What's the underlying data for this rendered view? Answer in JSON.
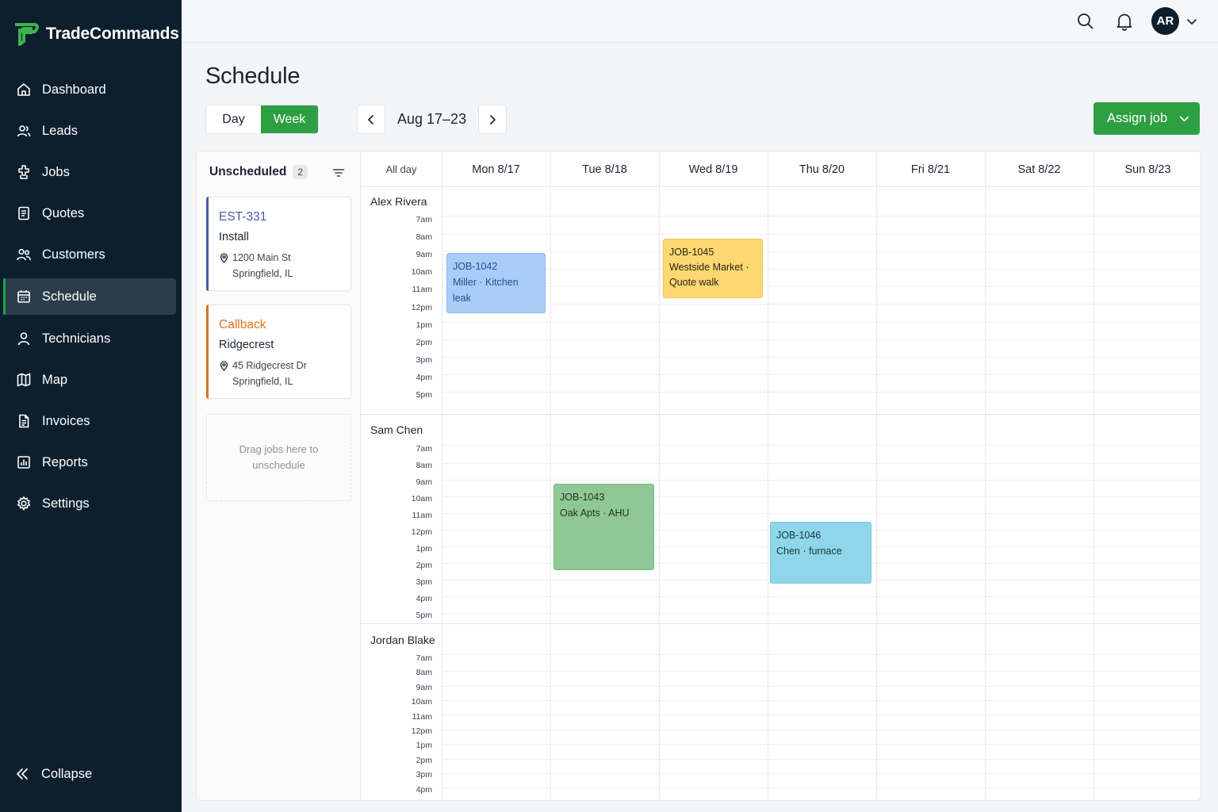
{
  "brand": {
    "name": "TradeCommands"
  },
  "sidebar": {
    "items": [
      {
        "label": "Dashboard",
        "icon": "home-icon"
      },
      {
        "label": "Leads",
        "icon": "users-icon"
      },
      {
        "label": "Jobs",
        "icon": "jobs-icon"
      },
      {
        "label": "Quotes",
        "icon": "document-icon"
      },
      {
        "label": "Customers",
        "icon": "customers-icon"
      },
      {
        "label": "Schedule",
        "icon": "calendar-icon",
        "active": true
      },
      {
        "label": "Technicians",
        "icon": "person-icon"
      },
      {
        "label": "Map",
        "icon": "map-icon"
      },
      {
        "label": "Invoices",
        "icon": "invoice-icon"
      },
      {
        "label": "Reports",
        "icon": "chart-icon"
      },
      {
        "label": "Settings",
        "icon": "gear-icon"
      }
    ],
    "collapse_label": "Collapse"
  },
  "topbar": {
    "avatar_initials": "AR"
  },
  "header": {
    "title": "Schedule",
    "view_day": "Day",
    "view_week": "Week",
    "active_view": "Week",
    "date_range": "Aug 17–23",
    "assign_label": "Assign job"
  },
  "unscheduled": {
    "title": "Unscheduled",
    "count": "2",
    "cards": [
      {
        "id": "EST-331",
        "type": "Install",
        "address_line1": "1200 Main St",
        "address_line2": "Springfield, IL",
        "accent": "#4b5ba8"
      },
      {
        "id": "Callback",
        "type": "Ridgecrest",
        "address_line1": "45 Ridgecrest Dr",
        "address_line2": "Springfield, IL",
        "accent": "#d9731f"
      }
    ],
    "dropzone_text": "Drag jobs here to unschedule"
  },
  "calendar": {
    "allday_label": "All day",
    "days": [
      "Mon 8/17",
      "Tue 8/18",
      "Wed 8/19",
      "Thu 8/20",
      "Fri 8/21",
      "Sat 8/22",
      "Sun 8/23"
    ],
    "hours": [
      "7am",
      "8am",
      "9am",
      "10am",
      "11am",
      "12pm",
      "1pm",
      "2pm",
      "3pm",
      "4pm",
      "5pm"
    ],
    "technicians": [
      {
        "name": "Alex Rivera",
        "events": [
          {
            "id": "JOB-1042",
            "line2": "Miller · Kitchen leak",
            "line3": "",
            "day": "Mon 8/17",
            "color": "blue"
          },
          {
            "id": "JOB-1045",
            "line2": "Westside Market ·",
            "line3": "Quote walk",
            "day": "Wed 8/19",
            "color": "yellow"
          }
        ]
      },
      {
        "name": "Sam Chen",
        "events": [
          {
            "id": "JOB-1043",
            "line2": "Oak Apts · AHU",
            "line3": "",
            "day": "Tue 8/18",
            "color": "green"
          },
          {
            "id": "JOB-1046",
            "line2": "Chen · furnace",
            "line3": "",
            "day": "Thu 8/20",
            "color": "cyan"
          }
        ]
      },
      {
        "name": "Jordan Blake",
        "events": []
      }
    ]
  },
  "colors": {
    "sidebar_bg": "#0d1f2d",
    "accent_green": "#2e9e43",
    "event_blue": "#a9cdf6",
    "event_yellow": "#fcd772",
    "event_green": "#8fc897",
    "event_cyan": "#8fd6ea"
  }
}
